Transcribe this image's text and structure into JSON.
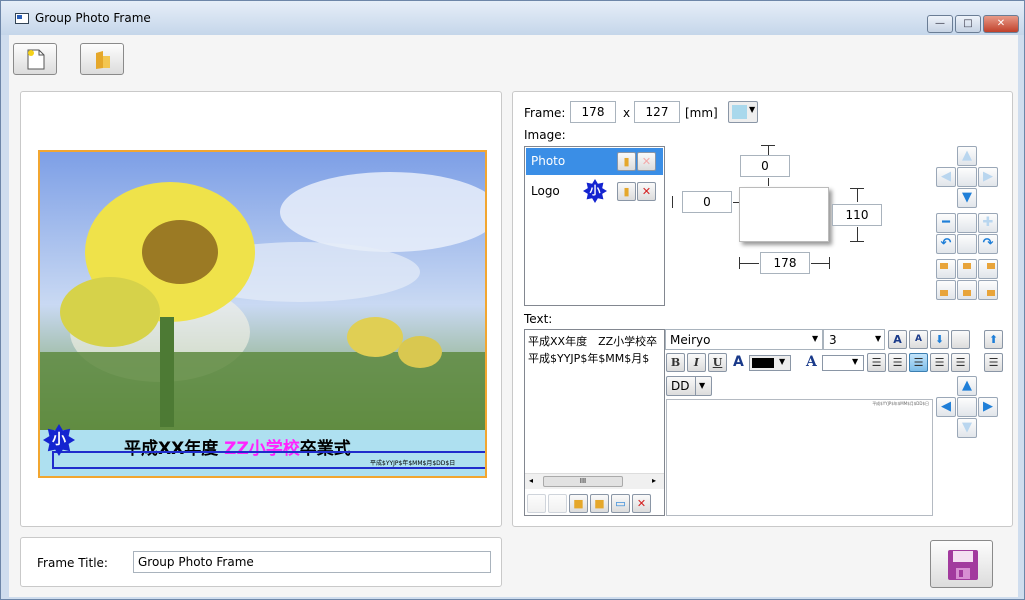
{
  "window": {
    "title": "Group Photo Frame",
    "min": "—",
    "max": "□",
    "close": "✕"
  },
  "toolbar": {
    "new_icon": "new-document-icon",
    "open_icon": "open-folder-icon"
  },
  "preview": {
    "banner_part1": "平成XX年度 ",
    "banner_part2": "ZZ小学校",
    "banner_part3": "卒業式",
    "small_text": "平成$YYJP$年$MM$月$DD$日",
    "logo_char": "小",
    "colors": {
      "frame": "#f2a630",
      "banner_bg": "#aee0f0",
      "highlight": "#ff22ff",
      "select": "#1f2ccc"
    }
  },
  "frame": {
    "label": "Frame:",
    "width": "178",
    "x": "x",
    "height": "127",
    "unit": "[mm]",
    "color": "#a9d8ec"
  },
  "image": {
    "label": "Image:",
    "items": [
      {
        "name": "Photo"
      },
      {
        "name": "Logo",
        "badge": "小"
      }
    ],
    "top": "0",
    "left": "0",
    "right": "110",
    "bottom": "178"
  },
  "text": {
    "label": "Text:",
    "items": [
      "平成XX年度　ZZ小学校卒",
      "平成$YYJP$年$MM$月$"
    ],
    "font": "Meiryo",
    "size": "3",
    "bold": "B",
    "italic": "I",
    "underline": "U",
    "font_color_glyph": "A",
    "bg_color_glyph": "A",
    "date_format": "DD",
    "scroll_mark": "III",
    "editor_small": "平成$YYJP$年$MM$月$DD$日"
  },
  "footer": {
    "frame_title_label": "Frame Title:",
    "frame_title_value": "Group Photo Frame"
  }
}
